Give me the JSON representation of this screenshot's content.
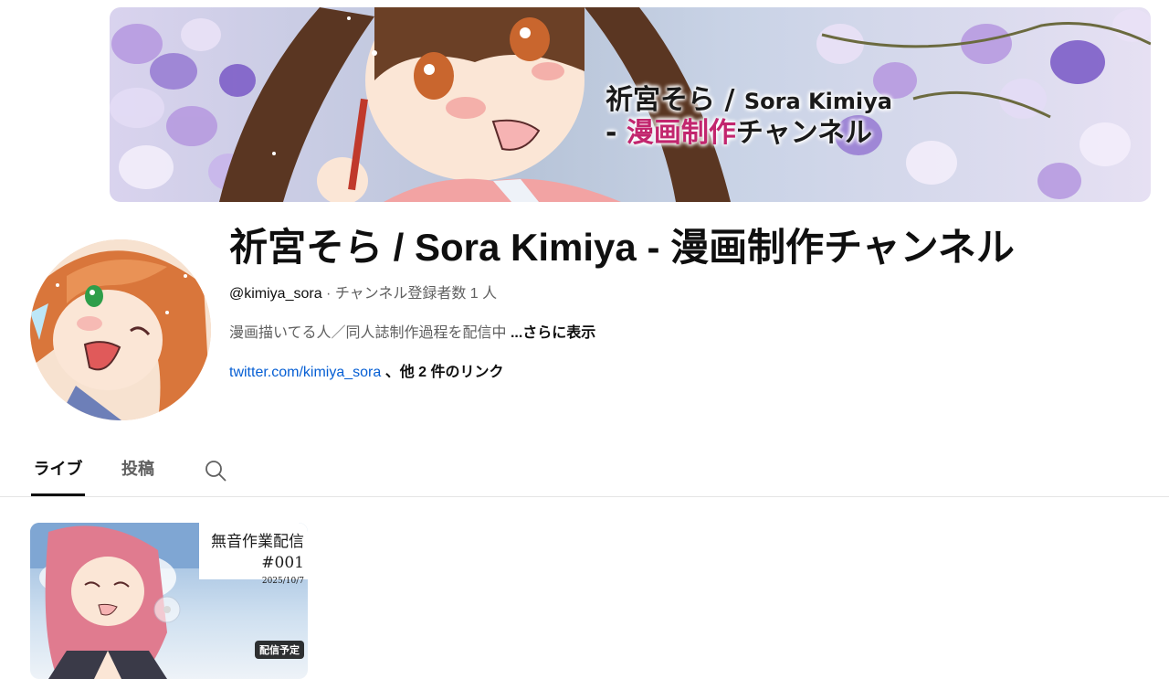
{
  "banner": {
    "title_jp": "祈宮そら / ",
    "title_en": "Sora Kimiya",
    "subtitle_dash": "- ",
    "subtitle_pink": "漫画制作",
    "subtitle_rest": "チャンネル"
  },
  "channel": {
    "name": "祈宮そら / Sora Kimiya - 漫画制作チャンネル",
    "handle": "@kimiya_sora",
    "separator": " · ",
    "subscribers": "チャンネル登録者数 1 人",
    "description": "漫画描いてる人／同人誌制作過程を配信中 ",
    "more_label": "...さらに表示",
    "link_text": "twitter.com/kimiya_sora",
    "other_links": " 、他 2 件のリンク"
  },
  "tabs": [
    {
      "label": "ライブ",
      "active": true
    },
    {
      "label": "投稿",
      "active": false
    }
  ],
  "video": {
    "thumb_title": "無音作業配信",
    "thumb_number": "#001",
    "thumb_date": "2025/10/7",
    "badge": "配信予定"
  },
  "colors": {
    "link": "#065fd4",
    "banner_pink": "#c2266e",
    "secondary_text": "#606060"
  }
}
